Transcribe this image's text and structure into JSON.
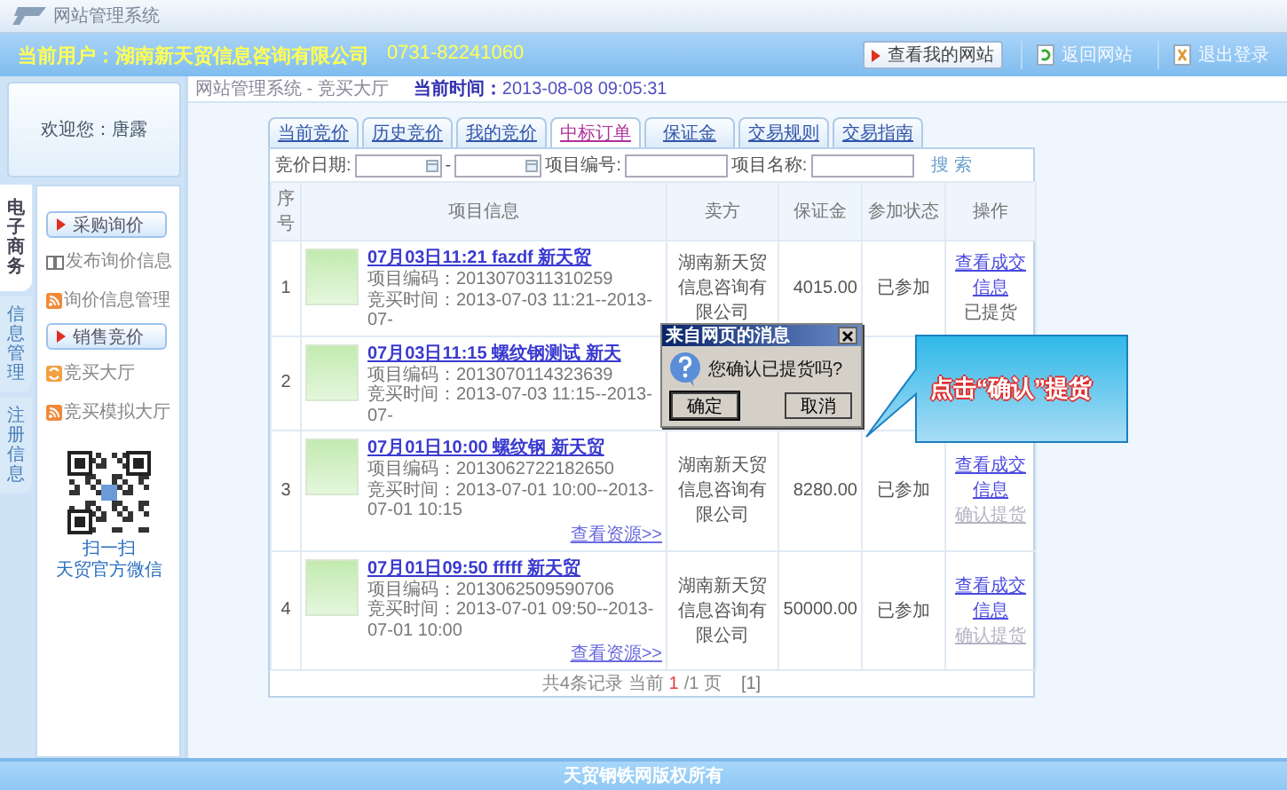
{
  "window": {
    "title": "网站管理系统"
  },
  "header": {
    "user": "当前用户：湖南新天贸信息咨询有限公司",
    "phone": "0731-82241060",
    "buttons": [
      {
        "label": "查看我的网站",
        "kind": "site"
      },
      {
        "label": "返回网站",
        "kind": "back"
      },
      {
        "label": "退出登录",
        "kind": "logout"
      }
    ]
  },
  "welcome": "欢迎您：唐露",
  "side_tabs": [
    {
      "label": "电子商务",
      "selected": true
    },
    {
      "label": "信息管理",
      "selected": false
    },
    {
      "label": "注册信息",
      "selected": false
    }
  ],
  "menu": [
    {
      "kind": "section",
      "label": "采购询价"
    },
    {
      "kind": "book-link",
      "label": "发布询价信息"
    },
    {
      "kind": "feed-link",
      "label": "询价信息管理"
    },
    {
      "kind": "section",
      "label": "销售竞价"
    },
    {
      "kind": "swirl-link",
      "label": "竞买大厅"
    },
    {
      "kind": "feed-link",
      "label": "竞买模拟大厅"
    }
  ],
  "qr_caption": [
    "扫一扫",
    "天贸官方微信"
  ],
  "breadcrumb": "网站管理系统 - 竞买大厅",
  "current_time": "**当前时间：**2013-08-08 09:05:31",
  "tabs": [
    {
      "label": "当前竞价",
      "selected": false
    },
    {
      "label": "历史竞价",
      "selected": false
    },
    {
      "label": "我的竞价",
      "selected": false
    },
    {
      "label": "中标订单",
      "selected": true
    },
    {
      "label": "保证金",
      "selected": false
    },
    {
      "label": "交易规则",
      "selected": false
    },
    {
      "label": "交易指南",
      "selected": false
    }
  ],
  "search": {
    "date_label": "竞价日期:",
    "dash": "-",
    "code_label": "项目编号:",
    "name_label": "项目名称:",
    "button": "搜 索"
  },
  "table": {
    "columns": [
      "序号",
      "项目信息",
      "卖方",
      "保证金",
      "参加状态",
      "操作"
    ],
    "rows": [
      {
        "no": "1",
        "title": "07月03日11:21 fazdf 新天贸",
        "code": "项目编码：2013070311310259",
        "time": "竞买时间：2013-07-03 11:21--2013-07-",
        "seller": "湖南新天贸信息咨询有限公司",
        "deposit": "4015.00",
        "status": "已参加",
        "link": "查看成交信息",
        "note": "已提货"
      },
      {
        "no": "2",
        "title": "07月03日11:15 螺纹钢测试 新天",
        "code": "项目编码：2013070114323639",
        "time": "竞买时间：2013-07-03 11:15--2013-07-"
      },
      {
        "no": "3",
        "title": "07月01日10:00 螺纹钢 新天贸",
        "code": "项目编码：2013062722182650",
        "time": "竞买时间：2013-07-01 10:00--2013-07-01 10:15",
        "resource": "查看资源>>",
        "seller": "湖南新天贸信息咨询有限公司",
        "deposit": "8280.00",
        "status": "已参加",
        "link": "查看成交信息",
        "action": {
          "label": "确认提货",
          "disabled": true
        }
      },
      {
        "no": "4",
        "title": "07月01日09:50 fffff 新天贸",
        "code": "项目编码：2013062509590706",
        "time": "竞买时间：2013-07-01 09:50--2013-07-01 10:00",
        "resource": "查看资源>>",
        "seller": "湖南新天贸信息咨询有限公司",
        "deposit": "50000.00",
        "status": "已参加",
        "link": "查看成交信息",
        "action": {
          "label": "确认提货",
          "disabled": true
        }
      }
    ]
  },
  "pagination": {
    "summary": "共4条记录 当前",
    "page": "1",
    "total": "/1 页",
    "pages": "[1]"
  },
  "dialog": {
    "title": "来自网页的消息",
    "message": "您确认已提货吗?",
    "buttons": [
      "确定",
      "取消"
    ]
  },
  "callout": "点击“确认”提货",
  "footer": "天贸钢铁网版权所有"
}
